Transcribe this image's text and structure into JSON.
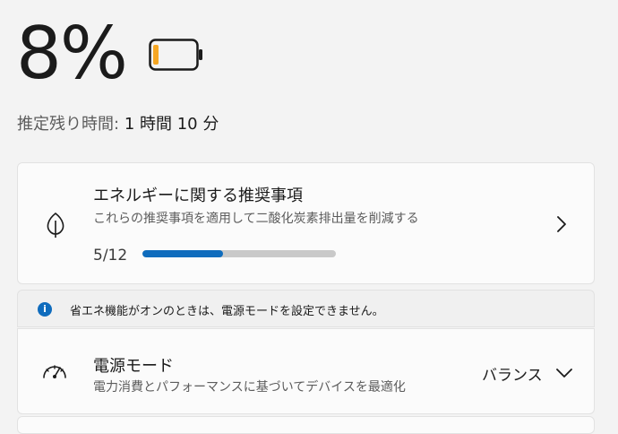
{
  "battery": {
    "percent_text": "8%",
    "level": 0.08,
    "accent_color": "#f5a623"
  },
  "estimate": {
    "label": "推定残り時間:",
    "value": "1 時間 10 分"
  },
  "recommendations": {
    "title": "エネルギーに関する推奨事項",
    "subtitle": "これらの推奨事項を適用して二酸化炭素排出量を削減する",
    "progress_text": "5/12",
    "progress_value": 5,
    "progress_total": 12,
    "icon": "leaf-icon",
    "progress_color": "#0f6cbd"
  },
  "info_banner": {
    "text": "省エネ機能がオンのときは、電源モードを設定できません。",
    "icon": "info-icon"
  },
  "power_mode": {
    "title": "電源モード",
    "subtitle": "電力消費とパフォーマンスに基づいてデバイスを最適化",
    "selected": "バランス",
    "icon": "gauge-icon"
  }
}
